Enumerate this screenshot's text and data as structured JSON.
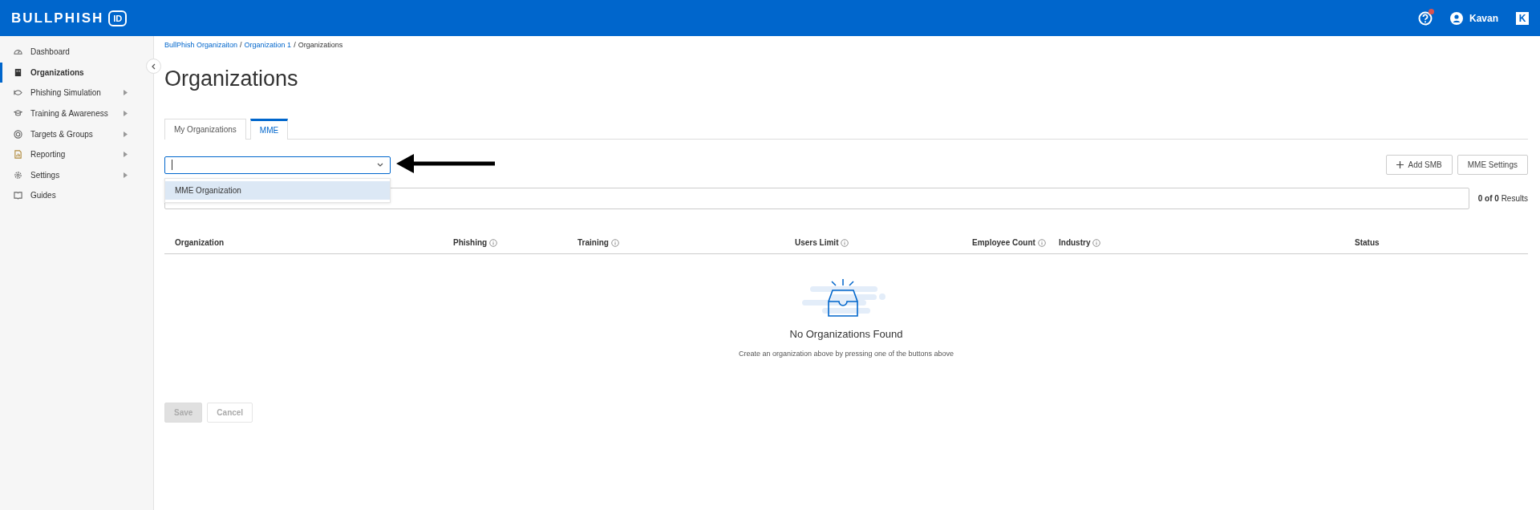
{
  "header": {
    "logo_text": "BULLPHISH",
    "logo_badge": "ID",
    "help_notification": true,
    "user": "Kavan",
    "app_badge": "K"
  },
  "sidebar": {
    "items": [
      {
        "label": "Dashboard",
        "selected": false,
        "has_submenu": false
      },
      {
        "label": "Organizations",
        "selected": true,
        "has_submenu": false
      },
      {
        "label": "Phishing Simulation",
        "selected": false,
        "has_submenu": true
      },
      {
        "label": "Training & Awareness",
        "selected": false,
        "has_submenu": true
      },
      {
        "label": "Targets & Groups",
        "selected": false,
        "has_submenu": true
      },
      {
        "label": "Reporting",
        "selected": false,
        "has_submenu": true
      },
      {
        "label": "Settings",
        "selected": false,
        "has_submenu": true
      },
      {
        "label": "Guides",
        "selected": false,
        "has_submenu": false
      }
    ]
  },
  "breadcrumb": {
    "separator": "/",
    "items": [
      {
        "label": "BullPhish Organizaiton",
        "link": true
      },
      {
        "label": "Organization 1",
        "link": true
      },
      {
        "label": "Organizations",
        "link": false
      }
    ]
  },
  "page_title": "Organizations",
  "tabs": [
    {
      "label": "My Organizations",
      "selected": false
    },
    {
      "label": "MME",
      "selected": true
    }
  ],
  "org_select": {
    "open": true,
    "options": [
      {
        "label": "MME Organization",
        "selected": true
      }
    ]
  },
  "actions": [
    {
      "label": "Add SMB",
      "kind": "add"
    },
    {
      "label": "MME Settings",
      "kind": "settings"
    }
  ],
  "results": {
    "count": "0 of 0",
    "label": "Results"
  },
  "table": {
    "columns": [
      {
        "label": "Organization",
        "info": false
      },
      {
        "label": "Phishing",
        "info": true
      },
      {
        "label": "Training",
        "info": true
      },
      {
        "label": "Users Limit",
        "info": true
      },
      {
        "label": "Employee Count",
        "info": true
      },
      {
        "label": "Industry",
        "info": true
      },
      {
        "label": "Status",
        "info": false
      }
    ]
  },
  "empty_state": {
    "title": "No Organizations Found",
    "message": "Create an organization above by pressing one of the buttons above"
  },
  "footer_buttons": [
    {
      "label": "Save",
      "disabled": true,
      "kind": "primary"
    },
    {
      "label": "Cancel",
      "disabled": true,
      "kind": "secondary"
    }
  ]
}
